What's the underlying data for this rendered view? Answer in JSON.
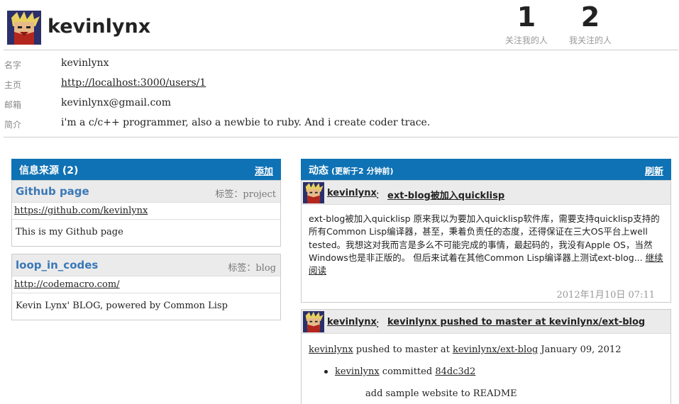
{
  "profile": {
    "username": "kevinlynx",
    "followers_count": "1",
    "followers_label": "关注我的人",
    "following_count": "2",
    "following_label": "我关注的人"
  },
  "info": {
    "name_label": "名字",
    "name_value": "kevinlynx",
    "home_label": "主页",
    "home_value": "http://localhost:3000/users/1",
    "email_label": "邮箱",
    "email_value": "kevinlynx@gmail.com",
    "intro_label": "简介",
    "intro_value": "i'm a c/c++ programmer, also a newbie to ruby. And i create coder trace."
  },
  "sources": {
    "title": "信息来源 (2)",
    "add_label": "添加",
    "items": [
      {
        "name": "Github page",
        "tag": "标签：project",
        "url": "https://github.com/kevinlynx",
        "desc": "This is my Github page"
      },
      {
        "name": "loop_in_codes",
        "tag": "标签：blog",
        "url": "http://codemacro.com/",
        "desc": "Kevin Lynx' BLOG, powered by Common Lisp"
      }
    ]
  },
  "activity": {
    "title": "动态",
    "subtitle": "(更新于2 分钟前)",
    "refresh_label": "刷新",
    "items": [
      {
        "user": "kevinlynx",
        "sep": "：",
        "headline": "ext-blog被加入quicklisp",
        "body": "ext-blog被加入quicklisp 原来我以为要加入quicklisp软件库，需要支持quicklisp支持的所有Common Lisp编译器，甚至，秉着负责任的态度，还得保证在三大OS平台上well tested。我想这对我而言是多么不可能完成的事情，最起码的，我没有Apple OS，当然Windows也是非正版的。 但后来试着在其他Common Lisp编译器上测试ext-blog...",
        "read_more": "继续阅读",
        "time": "2012年1月10日 07:11"
      },
      {
        "user": "kevinlynx",
        "sep": "：",
        "headline": "kevinlynx pushed to master at kevinlynx/ext-blog",
        "push_user": "kevinlynx",
        "push_text": " pushed to master at ",
        "push_repo": "kevinlynx/ext-blog",
        "push_date": " January 09, 2012",
        "commit_user": "kevinlynx",
        "commit_text": " committed ",
        "commit_hash": "84dc3d2",
        "commit_msg": "add sample website to README"
      }
    ]
  },
  "colors": {
    "panel_header": "#0f72b4",
    "source_name": "#3a78b8"
  }
}
